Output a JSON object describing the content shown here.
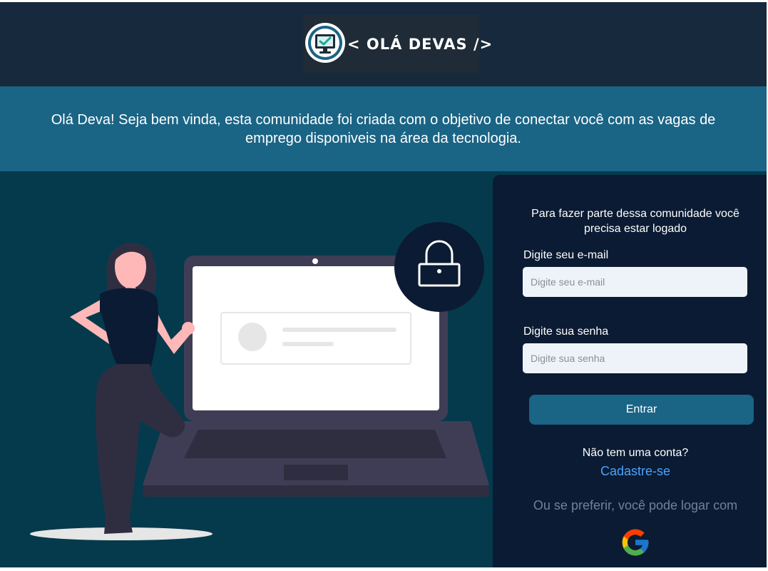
{
  "header": {
    "logo_text": "< OLÁ DEVAS />"
  },
  "banner": {
    "welcome_text": "Olá Deva! Seja bem vinda, esta comunidade foi criada com o objetivo de conectar você com as vagas de emprego disponiveis na área da tecnologia."
  },
  "illustration": {
    "figure": "woman-with-laptop-illustration",
    "badge_icon": "lock-icon"
  },
  "login": {
    "intro": "Para fazer parte dessa comunidade você precisa estar logado",
    "email_label": "Digite seu e-mail",
    "email_placeholder": "Digite seu e-mail",
    "email_value": "",
    "password_label": "Digite sua senha",
    "password_placeholder": "Digite sua senha",
    "password_value": "",
    "submit_label": "Entrar",
    "no_account_text": "Não tem uma conta?",
    "signup_link": "Cadastre-se",
    "alt_login_text": "Ou se preferir, você pode logar com",
    "alt_login_icon": "google-icon"
  },
  "colors": {
    "header_bg": "#172a3d",
    "banner_bg": "#1a6485",
    "page_bg": "#053a4c",
    "panel_bg": "#0b1b33",
    "button_bg": "#1a6485",
    "link": "#4aa3ff"
  }
}
